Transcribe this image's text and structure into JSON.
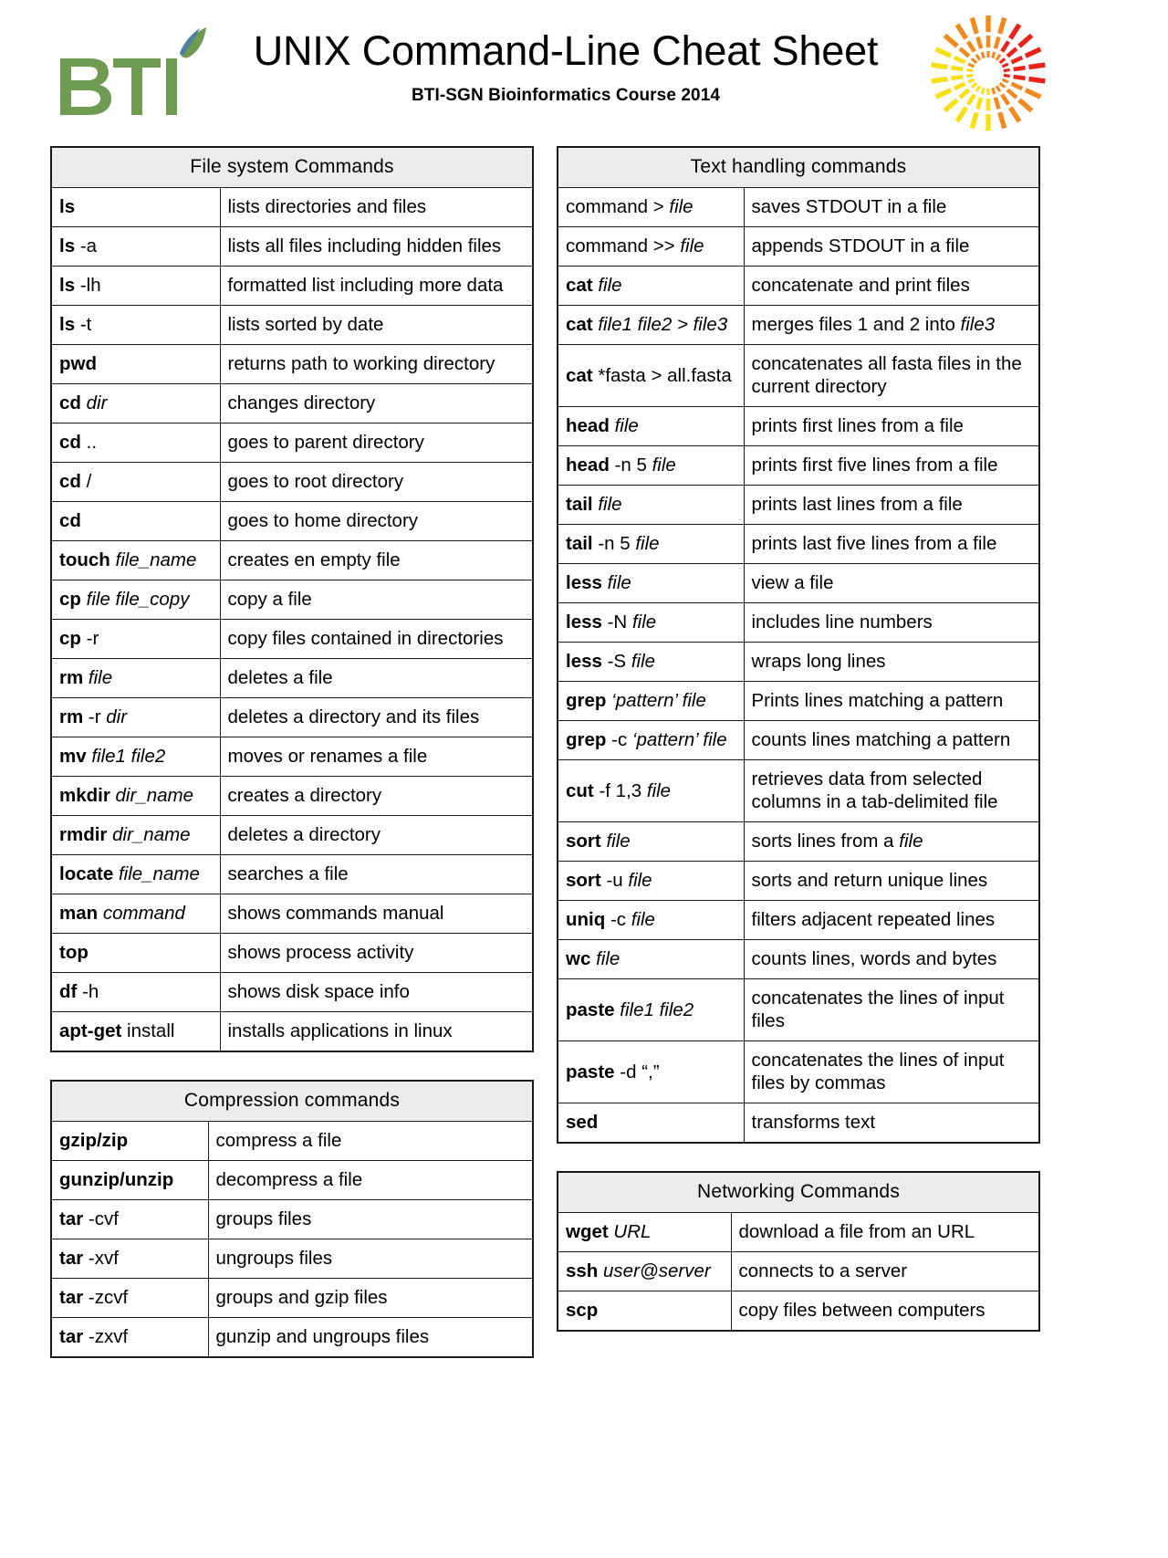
{
  "header": {
    "title": "UNIX Command-Line Cheat Sheet",
    "subtitle": "BTI-SGN Bioinformatics Course 2014",
    "logo_text": "BTI",
    "logo_alt": "bti-leaf-logo",
    "sun_alt": "sunburst-logo",
    "colors": {
      "logo_green": "#6f9a52",
      "logo_leaf_blue": "#4e7f9e",
      "sun_yellow": "#f7e017",
      "sun_orange": "#f08a1e",
      "sun_red": "#e8231a",
      "header_fill": "#ececec",
      "border": "#1a1a1a"
    }
  },
  "tables": [
    {
      "id": "file-system-commands",
      "column": "left",
      "header": "File system Commands",
      "rows": [
        {
          "cmd": "ls",
          "arg": "",
          "arg_style": "n",
          "desc": "lists directories and files"
        },
        {
          "cmd": "ls",
          "arg": "-a",
          "arg_style": "n",
          "desc": "lists all files including hidden files"
        },
        {
          "cmd": "ls",
          "arg": "-lh",
          "arg_style": "n",
          "desc": "formatted list including more data"
        },
        {
          "cmd": "ls",
          "arg": "-t",
          "arg_style": "n",
          "desc": "lists sorted by date"
        },
        {
          "cmd": "pwd",
          "arg": "",
          "arg_style": "n",
          "desc": "returns path to working directory"
        },
        {
          "cmd": "cd",
          "arg": "dir",
          "arg_style": "i",
          "desc": "changes directory"
        },
        {
          "cmd": "cd",
          "arg": "..",
          "arg_style": "n",
          "desc": "goes to parent directory"
        },
        {
          "cmd": "cd",
          "arg": "/",
          "arg_style": "n",
          "desc": "goes to root directory"
        },
        {
          "cmd": "cd",
          "arg": "",
          "arg_style": "n",
          "desc": "goes to home directory"
        },
        {
          "cmd": "touch",
          "arg": "file_name",
          "arg_style": "i",
          "desc": "creates en empty file"
        },
        {
          "cmd": "cp",
          "arg": "file file_copy",
          "arg_style": "i",
          "desc": "copy a file"
        },
        {
          "cmd": "cp",
          "arg": "-r",
          "arg_style": "n",
          "desc": "copy files contained in directories"
        },
        {
          "cmd": "rm",
          "arg": "file",
          "arg_style": "i",
          "desc": "deletes a file"
        },
        {
          "cmd": "rm",
          "arg": "-r dir",
          "arg_style": "mix-nr-i",
          "desc": "deletes a directory and its files"
        },
        {
          "cmd": "mv",
          "arg": "file1  file2",
          "arg_style": "i",
          "desc": "moves or renames a file"
        },
        {
          "cmd": "mkdir",
          "arg": "dir_name",
          "arg_style": "i",
          "desc": "creates a directory"
        },
        {
          "cmd": "rmdir",
          "arg": "dir_name",
          "arg_style": "i",
          "desc": "deletes a directory"
        },
        {
          "cmd": "locate",
          "arg": "file_name",
          "arg_style": "i",
          "desc": "searches a file"
        },
        {
          "cmd": "man",
          "arg": "command",
          "arg_style": "i",
          "desc": "shows commands manual"
        },
        {
          "cmd": "top",
          "arg": "",
          "arg_style": "n",
          "desc": "shows process activity"
        },
        {
          "cmd": "df",
          "arg": "-h",
          "arg_style": "n",
          "desc": "shows disk space info"
        },
        {
          "cmd": "apt-get",
          "arg": "install",
          "arg_style": "n",
          "desc": "installs applications in linux"
        }
      ]
    },
    {
      "id": "compression-commands",
      "column": "left",
      "header": "Compression commands",
      "rows": [
        {
          "cmd": "gzip/zip",
          "arg": "",
          "arg_style": "n",
          "desc": "compress a file"
        },
        {
          "cmd": "gunzip/unzip",
          "arg": "",
          "arg_style": "n",
          "desc": "decompress a file"
        },
        {
          "cmd": "tar",
          "arg": "-cvf",
          "arg_style": "n",
          "desc": "groups files"
        },
        {
          "cmd": "tar",
          "arg": "-xvf",
          "arg_style": "n",
          "desc": "ungroups files"
        },
        {
          "cmd": "tar",
          "arg": "-zcvf",
          "arg_style": "n",
          "desc": "groups and gzip files"
        },
        {
          "cmd": "tar",
          "arg": "-zxvf",
          "arg_style": "n",
          "desc": "gunzip and ungroups files"
        }
      ]
    },
    {
      "id": "text-handling-commands",
      "column": "right",
      "header": "Text handling commands",
      "rows": [
        {
          "cmd": "",
          "cmd_style": "n",
          "arg": "command > file",
          "arg_style": "plain-then-i",
          "plain": "command > ",
          "ital": "file",
          "desc": "saves STDOUT in a file"
        },
        {
          "cmd": "",
          "cmd_style": "n",
          "arg": "command  >> file",
          "arg_style": "plain-then-i",
          "plain": "command  >> ",
          "ital": "file",
          "desc": "appends STDOUT in a file"
        },
        {
          "cmd": "cat",
          "arg": "file",
          "arg_style": "i",
          "desc": "concatenate and print files"
        },
        {
          "cmd": "cat",
          "arg": "file1  file2 > file3",
          "arg_style": "i",
          "desc": "merges files 1 and 2 into file3",
          "desc_tail_i": "file3"
        },
        {
          "cmd": "cat",
          "arg": "*fasta > all.fasta",
          "arg_style": "n",
          "desc": "concatenates all fasta files in the current directory"
        },
        {
          "cmd": "head",
          "arg": "file",
          "arg_style": "i",
          "desc": "prints first lines from a file"
        },
        {
          "cmd": "head",
          "arg": "-n 5 file",
          "arg_style": "mix-n5-i",
          "desc": "prints first five lines from a file"
        },
        {
          "cmd": "tail",
          "arg": "file",
          "arg_style": "i",
          "desc": "prints last lines from a file"
        },
        {
          "cmd": "tail",
          "arg": "-n 5 file",
          "arg_style": "mix-n5-i",
          "desc": "prints last five lines from a file"
        },
        {
          "cmd": "less",
          "arg": "file",
          "arg_style": "i",
          "desc": "view a file"
        },
        {
          "cmd": "less",
          "arg": "-N file",
          "arg_style": "mix-nr-i",
          "desc": "includes line numbers"
        },
        {
          "cmd": "less",
          "arg": "-S file",
          "arg_style": "mix-nr-i",
          "desc": "wraps long lines"
        },
        {
          "cmd": "grep",
          "arg": "‘pattern’ file",
          "arg_style": "i",
          "desc": "Prints lines matching a pattern"
        },
        {
          "cmd": "grep",
          "arg": "-c ‘pattern’ file",
          "arg_style": "mix-nr-i",
          "desc": "counts lines matching a pattern"
        },
        {
          "cmd": "cut",
          "arg": "-f 1,3 file",
          "arg_style": "mix-n5-i",
          "desc": "retrieves data from selected columns in a tab-delimited file"
        },
        {
          "cmd": "sort",
          "arg": "file",
          "arg_style": "i",
          "desc": "sorts lines from a file",
          "desc_tail_i": "file"
        },
        {
          "cmd": "sort",
          "arg": "-u file",
          "arg_style": "mix-nr-i",
          "desc": "sorts and return unique lines"
        },
        {
          "cmd": "uniq",
          "arg": "-c file",
          "arg_style": "mix-nr-i",
          "desc": "filters adjacent repeated lines"
        },
        {
          "cmd": "wc",
          "arg": "file",
          "arg_style": "i",
          "desc": "counts lines, words and bytes"
        },
        {
          "cmd": "paste",
          "arg": "file1  file2",
          "arg_style": "i",
          "desc": "concatenates the lines of input files"
        },
        {
          "cmd": "paste",
          "arg": "-d “,”",
          "arg_style": "n",
          "desc": "concatenates the lines of input files by commas"
        },
        {
          "cmd": "sed",
          "arg": "",
          "arg_style": "n",
          "desc": "transforms text"
        }
      ]
    },
    {
      "id": "networking-commands",
      "column": "right",
      "header": "Networking Commands",
      "rows": [
        {
          "cmd": "wget",
          "arg": "URL",
          "arg_style": "i",
          "desc": "download a file from an URL"
        },
        {
          "cmd": "ssh",
          "arg": "user@server",
          "arg_style": "i",
          "desc": "connects to a server"
        },
        {
          "cmd": "scp",
          "arg": "",
          "arg_style": "n",
          "desc": "copy files between computers"
        }
      ]
    }
  ]
}
